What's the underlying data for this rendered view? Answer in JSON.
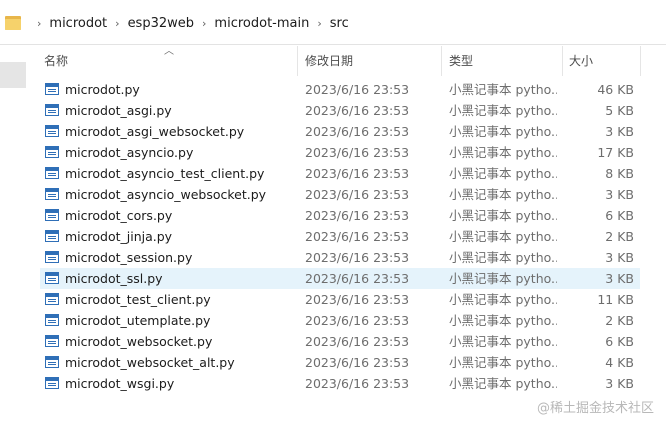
{
  "breadcrumb": [
    "microdot",
    "esp32web",
    "microdot-main",
    "src"
  ],
  "columns": {
    "name": "名称",
    "date": "修改日期",
    "type": "类型",
    "size": "大小"
  },
  "files": [
    {
      "name": "microdot.py",
      "date": "2023/6/16 23:53",
      "type": "小黑记事本 pytho...",
      "size": "46 KB"
    },
    {
      "name": "microdot_asgi.py",
      "date": "2023/6/16 23:53",
      "type": "小黑记事本 pytho...",
      "size": "5 KB"
    },
    {
      "name": "microdot_asgi_websocket.py",
      "date": "2023/6/16 23:53",
      "type": "小黑记事本 pytho...",
      "size": "3 KB"
    },
    {
      "name": "microdot_asyncio.py",
      "date": "2023/6/16 23:53",
      "type": "小黑记事本 pytho...",
      "size": "17 KB"
    },
    {
      "name": "microdot_asyncio_test_client.py",
      "date": "2023/6/16 23:53",
      "type": "小黑记事本 pytho...",
      "size": "8 KB"
    },
    {
      "name": "microdot_asyncio_websocket.py",
      "date": "2023/6/16 23:53",
      "type": "小黑记事本 pytho...",
      "size": "3 KB"
    },
    {
      "name": "microdot_cors.py",
      "date": "2023/6/16 23:53",
      "type": "小黑记事本 pytho...",
      "size": "6 KB"
    },
    {
      "name": "microdot_jinja.py",
      "date": "2023/6/16 23:53",
      "type": "小黑记事本 pytho...",
      "size": "2 KB"
    },
    {
      "name": "microdot_session.py",
      "date": "2023/6/16 23:53",
      "type": "小黑记事本 pytho...",
      "size": "3 KB"
    },
    {
      "name": "microdot_ssl.py",
      "date": "2023/6/16 23:53",
      "type": "小黑记事本 pytho...",
      "size": "3 KB",
      "selected": true
    },
    {
      "name": "microdot_test_client.py",
      "date": "2023/6/16 23:53",
      "type": "小黑记事本 pytho...",
      "size": "11 KB"
    },
    {
      "name": "microdot_utemplate.py",
      "date": "2023/6/16 23:53",
      "type": "小黑记事本 pytho...",
      "size": "2 KB"
    },
    {
      "name": "microdot_websocket.py",
      "date": "2023/6/16 23:53",
      "type": "小黑记事本 pytho...",
      "size": "6 KB"
    },
    {
      "name": "microdot_websocket_alt.py",
      "date": "2023/6/16 23:53",
      "type": "小黑记事本 pytho...",
      "size": "4 KB"
    },
    {
      "name": "microdot_wsgi.py",
      "date": "2023/6/16 23:53",
      "type": "小黑记事本 pytho...",
      "size": "3 KB"
    }
  ],
  "watermark": "@稀土掘金技术社区",
  "icons": {
    "folder": "folder-icon",
    "chevron": "chevron-right-icon",
    "file": "python-file-icon",
    "sort": "sort-up-icon"
  }
}
